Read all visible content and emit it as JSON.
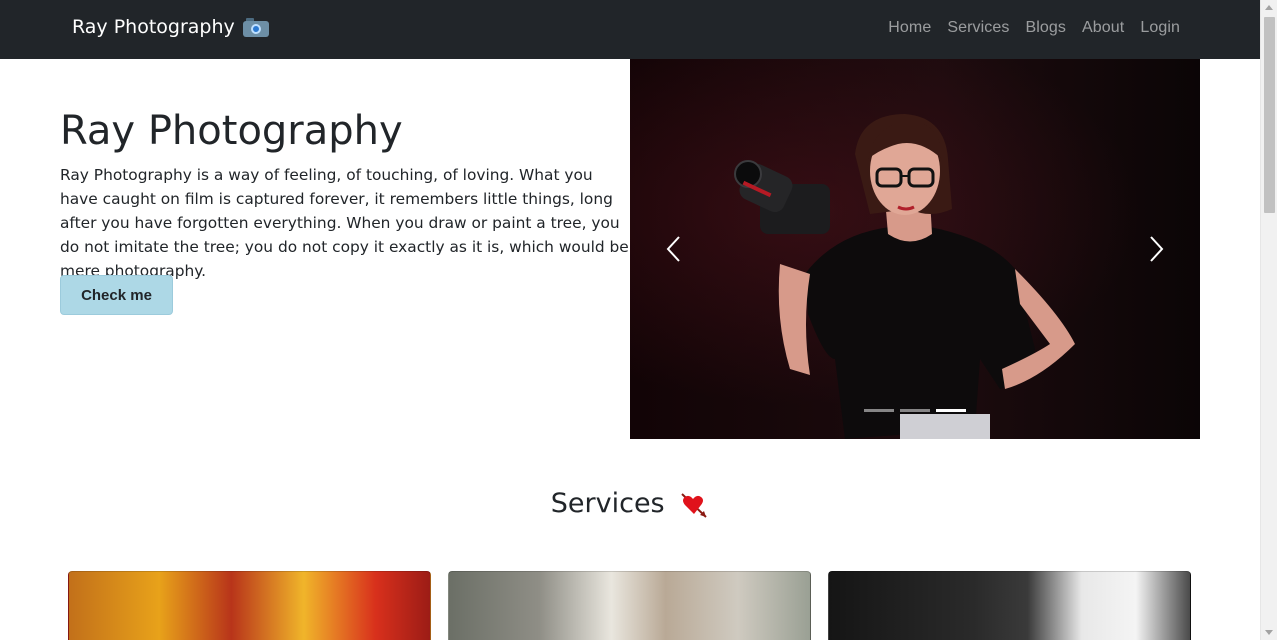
{
  "navbar": {
    "brand": "Ray Photography",
    "brand_icon": "camera-icon",
    "links": [
      "Home",
      "Services",
      "Blogs",
      "About",
      "Login"
    ]
  },
  "hero": {
    "title": "Ray Photography",
    "text": "Ray Photography is a way of feeling, of touching, of loving. What you have caught on film is captured forever, it remembers little things, long after you have forgotten everything. When you draw or paint a tree, you do not imitate the tree; you do not copy it exactly as it is, which would be mere photography.",
    "button_label": "Check me"
  },
  "carousel": {
    "slide_count": 3,
    "active_slide": 3,
    "prev_icon": "chevron-left-icon",
    "next_icon": "chevron-right-icon"
  },
  "services": {
    "title": "Services",
    "title_icon": "heart-arrow-icon"
  },
  "colors": {
    "navbar_bg": "#212529",
    "button_bg": "#add8e6",
    "heart": "#e0121b"
  }
}
